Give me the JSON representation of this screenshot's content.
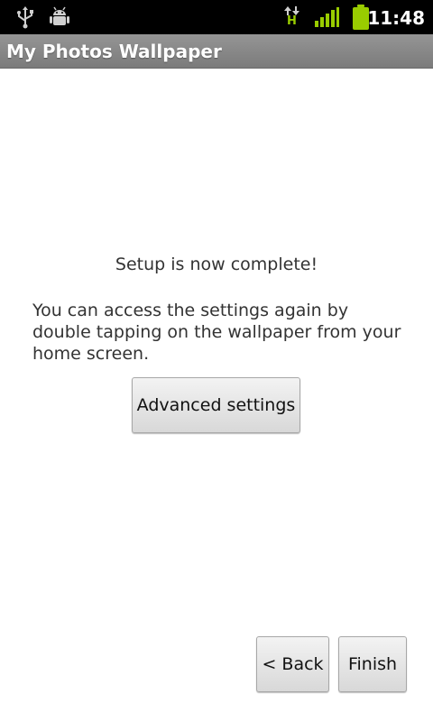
{
  "status_bar": {
    "icons": [
      "usb-icon",
      "debug-icon",
      "hspa-data-icon",
      "signal-icon",
      "battery-icon"
    ],
    "network_type": "H",
    "time": "11:48",
    "accent_color": "#99cc00"
  },
  "app": {
    "title": "My Photos Wallpaper"
  },
  "content": {
    "complete_message": "Setup is now complete!",
    "info_message": "You can access the settings again by double tapping on the wallpaper from your home screen.",
    "advanced_settings_label": "Advanced settings"
  },
  "footer": {
    "back_label": "< Back",
    "finish_label": "Finish"
  }
}
